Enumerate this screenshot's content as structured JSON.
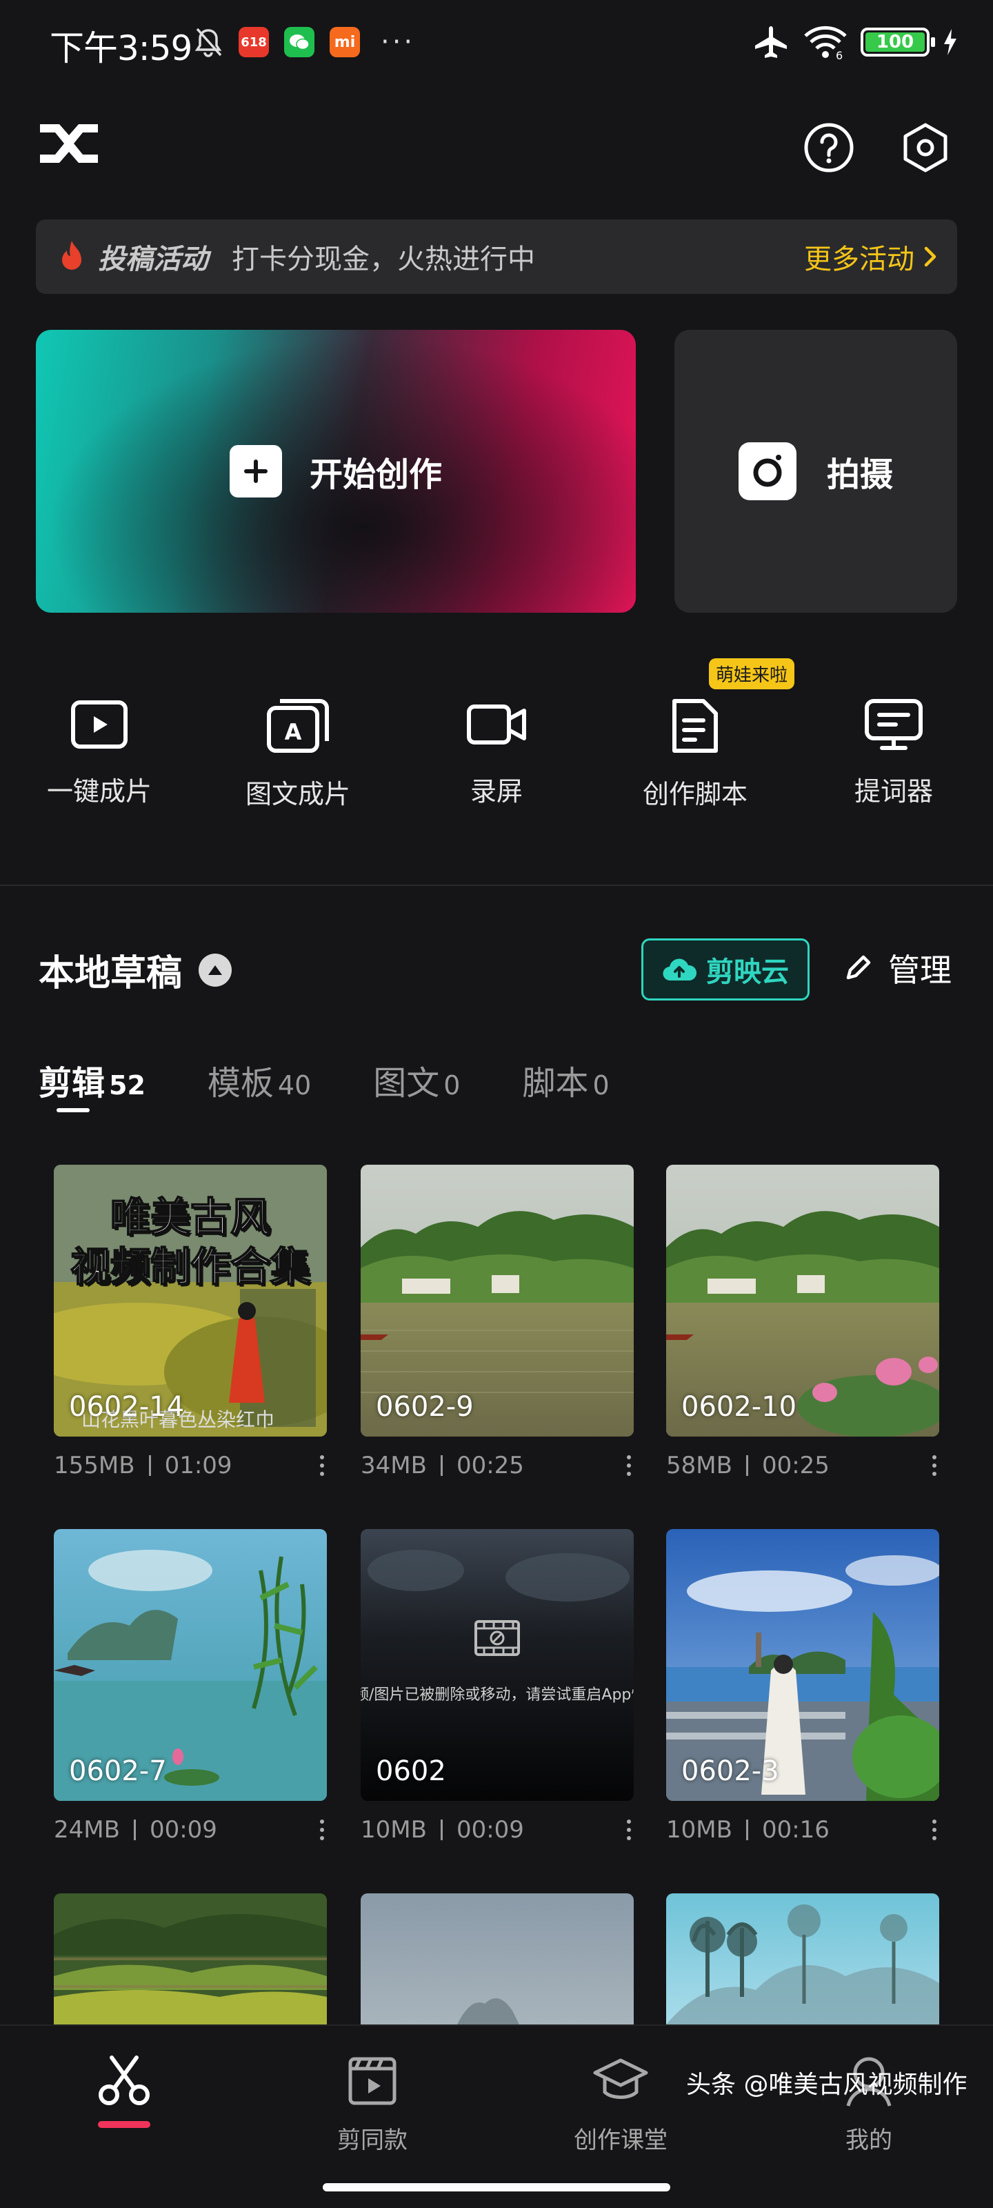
{
  "status_bar": {
    "time": "下午3:59",
    "battery": "100",
    "app_icons": [
      "bell-off-icon",
      "618-app-icon",
      "wechat-icon",
      "mi-icon"
    ]
  },
  "header": {
    "logo": "capcut-logo",
    "help_icon": "help-icon",
    "settings_icon": "settings-icon"
  },
  "banner": {
    "tag": "投稿活动",
    "text": "打卡分现金，火热进行中",
    "more": "更多活动"
  },
  "create_card": {
    "label": "开始创作"
  },
  "shoot_card": {
    "label": "拍摄"
  },
  "tools": [
    {
      "label": "一键成片"
    },
    {
      "label": "图文成片"
    },
    {
      "label": "录屏"
    },
    {
      "label": "创作脚本",
      "badge": "萌娃来啦"
    },
    {
      "label": "提词器"
    }
  ],
  "drafts": {
    "title": "本地草稿",
    "cloud_button": "剪映云",
    "manage_button": "管理",
    "tabs": [
      {
        "label": "剪辑",
        "count": "52"
      },
      {
        "label": "模板",
        "count": "40"
      },
      {
        "label": "图文",
        "count": "0"
      },
      {
        "label": "脚本",
        "count": "0"
      }
    ],
    "items": [
      {
        "name": "0602-14",
        "size": "155MB",
        "duration": "01:09",
        "overlay_line1": "唯美古风",
        "overlay_line2": "视频制作合集",
        "subtitle": "山花黑叶暮色丛染红巾"
      },
      {
        "name": "0602-9",
        "size": "34MB",
        "duration": "00:25"
      },
      {
        "name": "0602-10",
        "size": "58MB",
        "duration": "00:25"
      },
      {
        "name": "0602-7",
        "size": "24MB",
        "duration": "00:09"
      },
      {
        "name": "0602",
        "size": "10MB",
        "duration": "00:09",
        "missing_text": "频/图片已被删除或移动，请尝试重启App恢"
      },
      {
        "name": "0602-3",
        "size": "10MB",
        "duration": "00:16"
      }
    ]
  },
  "bottom_nav": [
    {
      "label": ""
    },
    {
      "label": "剪同款"
    },
    {
      "label": "创作课堂"
    },
    {
      "label": "我的"
    }
  ],
  "watermark": "头条 @唯美古风视频制作",
  "colors": {
    "accent_teal": "#2fd6c0",
    "accent_yellow": "#f5c518",
    "accent_red": "#f0335a",
    "background": "#151517"
  }
}
